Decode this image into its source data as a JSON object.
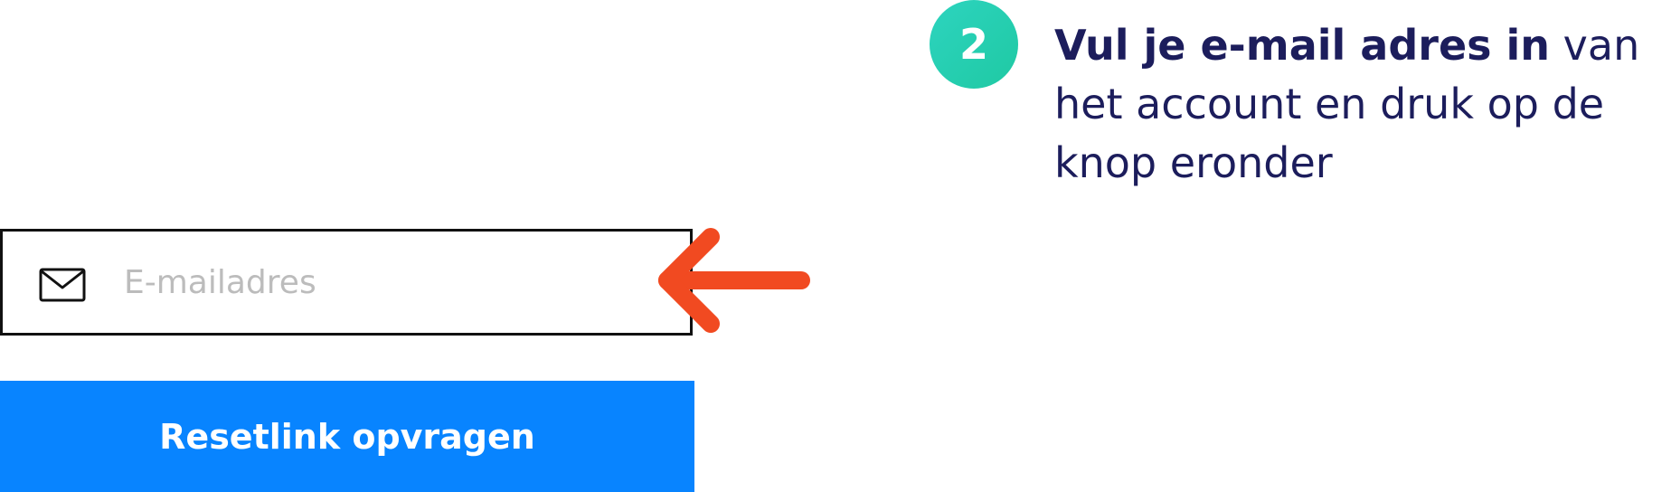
{
  "form": {
    "email_placeholder": "E-mailadres",
    "email_value": "",
    "submit_label": "Resetlink opvragen",
    "icons": {
      "email": "envelope-icon"
    }
  },
  "annotation": {
    "arrow_icon": "arrow-left-icon"
  },
  "step": {
    "number": "2",
    "bold_text": "Vul je e-mail adres in",
    "rest_text": " van het account en druk op de knop eronder"
  },
  "colors": {
    "button": "#0884ff",
    "arrow": "#f14a21",
    "badge": "#2dd4bf",
    "instruction_text": "#1c1d5c",
    "placeholder": "#bcbcbc",
    "border": "#111111"
  }
}
